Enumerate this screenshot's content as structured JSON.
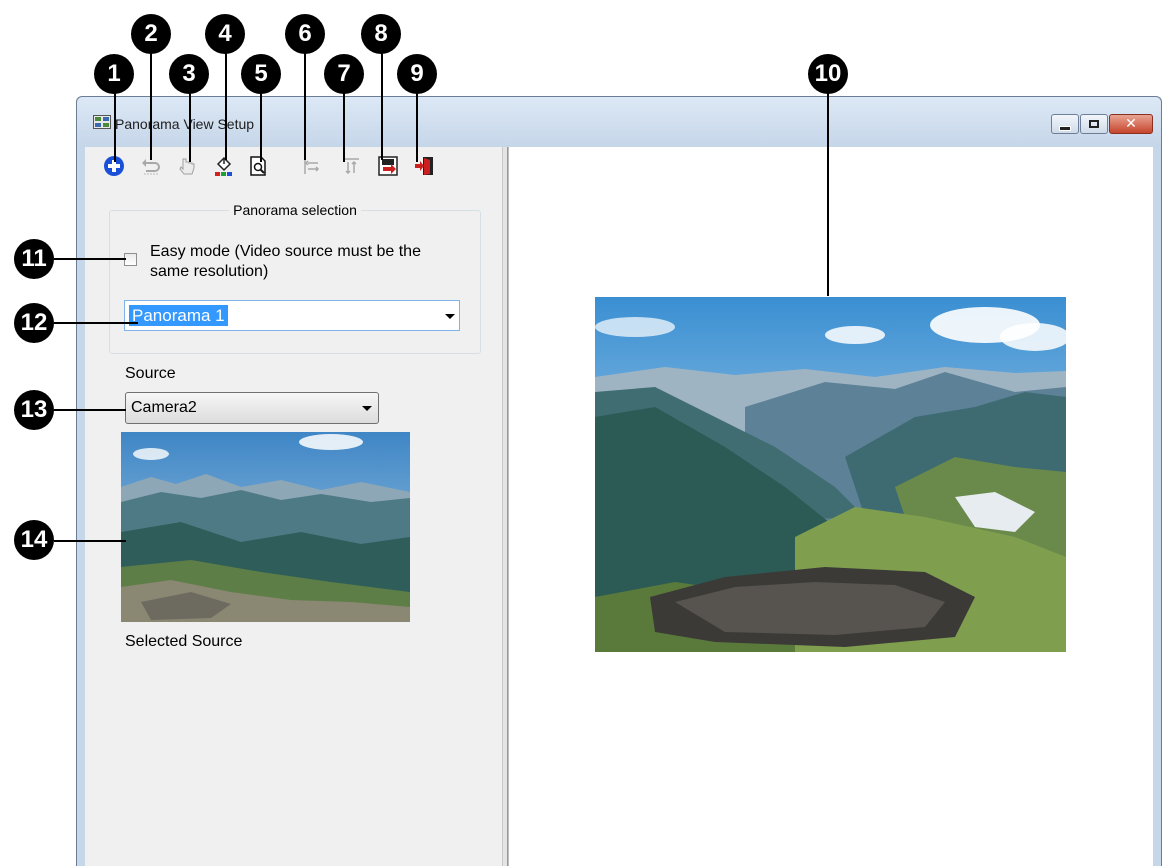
{
  "window": {
    "title": "Panorama View Setup",
    "icon": "panorama-app-icon",
    "controls": [
      "minimize-icon",
      "maximize-icon",
      "close-icon"
    ]
  },
  "toolbar": {
    "buttons": [
      {
        "icon": "add-icon",
        "enabled": true,
        "color": "#1a4fd8"
      },
      {
        "icon": "undo-icon",
        "enabled": false
      },
      {
        "icon": "hand-pointer-icon",
        "enabled": false
      },
      {
        "icon": "paint-bucket-icon",
        "enabled": true
      },
      {
        "icon": "preview-document-icon",
        "enabled": true
      },
      {
        "icon": "align-left-icon",
        "enabled": false
      },
      {
        "icon": "align-top-icon",
        "enabled": false
      },
      {
        "icon": "save-exit-icon",
        "enabled": true,
        "color": "#cc1f1f"
      },
      {
        "icon": "exit-door-icon",
        "enabled": true,
        "color": "#cc1f1f"
      }
    ]
  },
  "panorama_selection": {
    "legend": "Panorama selection",
    "easy_mode_label": "Easy mode (Video source must be the same resolution)",
    "easy_mode_checked": false,
    "selected_panorama": "Panorama 1"
  },
  "source": {
    "label": "Source",
    "selected_camera": "Camera2",
    "caption": "Selected Source"
  },
  "callouts": [
    "1",
    "2",
    "3",
    "4",
    "5",
    "6",
    "7",
    "8",
    "9",
    "10",
    "11",
    "12",
    "13",
    "14"
  ],
  "colors": {
    "selection_highlight": "#3399ff",
    "callout_fill": "#000000",
    "window_frame": "#c7d7ea",
    "close_button": "#c6452c"
  }
}
